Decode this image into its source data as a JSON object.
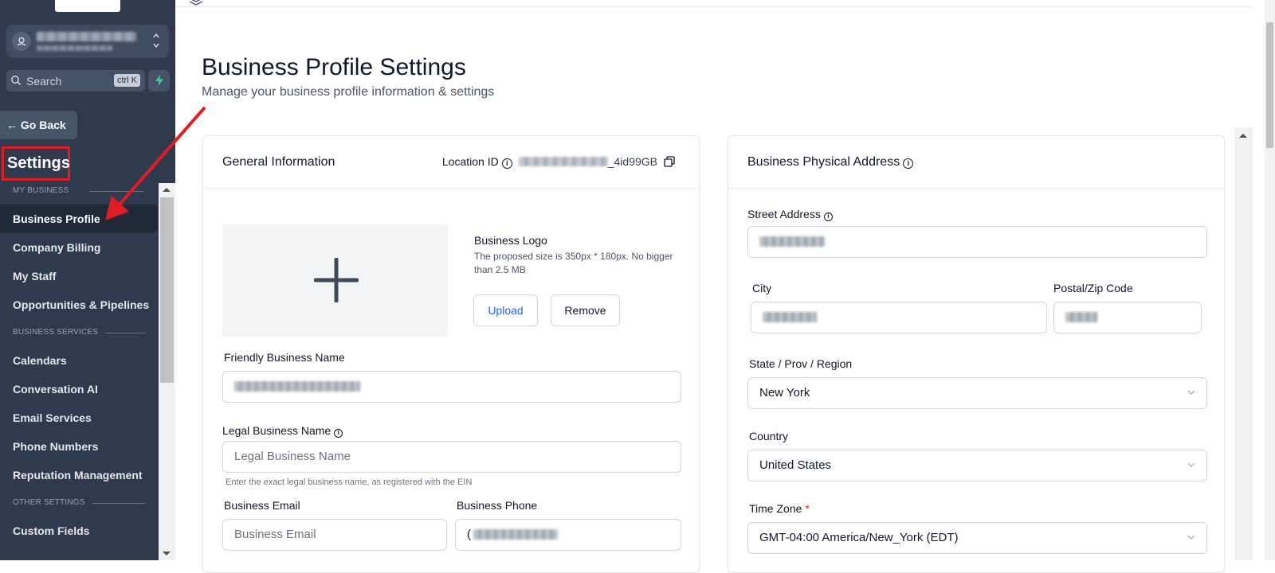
{
  "sidebar": {
    "search": {
      "placeholder": "Search",
      "shortcut": "ctrl K"
    },
    "go_back": "← Go Back",
    "title": "Settings",
    "sections": [
      {
        "label": "MY BUSINESS"
      },
      {
        "label": "BUSINESS SERVICES"
      },
      {
        "label": "OTHER SETTINGS"
      }
    ],
    "items": [
      {
        "label": "Business Profile",
        "active": true
      },
      {
        "label": "Company Billing"
      },
      {
        "label": "My Staff"
      },
      {
        "label": "Opportunities & Pipelines"
      },
      {
        "label": "Calendars"
      },
      {
        "label": "Conversation AI"
      },
      {
        "label": "Email Services"
      },
      {
        "label": "Phone Numbers"
      },
      {
        "label": "Reputation Management"
      },
      {
        "label": "Custom Fields"
      }
    ]
  },
  "page": {
    "title": "Business Profile Settings",
    "subtitle": "Manage your business profile information & settings"
  },
  "general": {
    "title": "General Information",
    "location_id_label": "Location ID",
    "location_id_suffix": "4id99GB",
    "logo_label": "Business Logo",
    "logo_hint": "The proposed size is 350px * 180px. No bigger than 2.5 MB",
    "upload": "Upload",
    "remove": "Remove",
    "friendly_name_label": "Friendly Business Name",
    "legal_name_label": "Legal Business Name",
    "legal_name_placeholder": "Legal Business Name",
    "legal_name_helper": "Enter the exact legal business name, as registered with the EIN",
    "email_label": "Business Email",
    "email_placeholder": "Business Email",
    "phone_label": "Business Phone",
    "phone_prefix": "("
  },
  "address": {
    "title": "Business Physical Address",
    "street_label": "Street Address",
    "city_label": "City",
    "zip_label": "Postal/Zip Code",
    "state_label": "State / Prov / Region",
    "state_value": "New York",
    "country_label": "Country",
    "country_value": "United States",
    "timezone_label": "Time Zone",
    "timezone_required": "*",
    "timezone_value": "GMT-04:00 America/New_York (EDT)"
  },
  "colors": {
    "sidebar": "#2f3a4f",
    "accent_link": "#2563eb",
    "annotation": "#e11d22"
  }
}
